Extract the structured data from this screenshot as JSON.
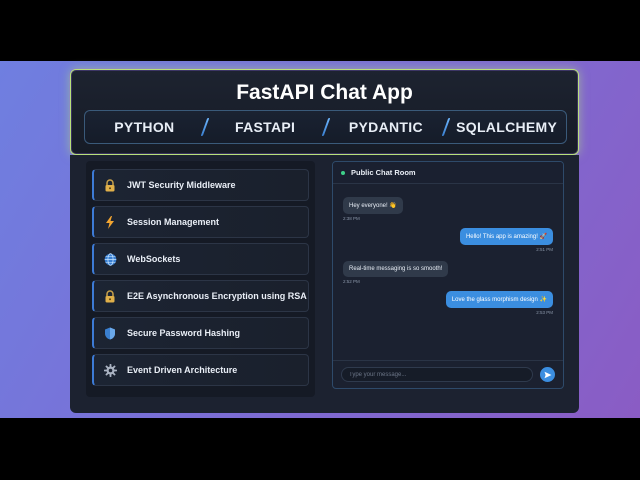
{
  "app": {
    "title": "FastAPI Chat App"
  },
  "tech_stack": [
    "PYTHON",
    "FASTAPI",
    "PYDANTIC",
    "SQLALCHEMY"
  ],
  "features": [
    {
      "label": "JWT Security Middleware",
      "icon": "lock-icon"
    },
    {
      "label": "Session Management",
      "icon": "lightning-icon"
    },
    {
      "label": "WebSockets",
      "icon": "globe-icon"
    },
    {
      "label": "E2E Asynchronous Encryption using RSA",
      "icon": "lock-icon"
    },
    {
      "label": "Secure Password Hashing",
      "icon": "shield-icon"
    },
    {
      "label": "Event Driven Architecture",
      "icon": "gear-icon"
    }
  ],
  "chat": {
    "room_title": "Public Chat Room",
    "messages": [
      {
        "text": "Hey everyone! 👋",
        "time": "2:38 PM",
        "direction": "in"
      },
      {
        "text": "Hello! This app is amazing! 🚀",
        "time": "2:51 PM",
        "direction": "out"
      },
      {
        "text": "Real-time messaging is so smooth!",
        "time": "2:52 PM",
        "direction": "in"
      },
      {
        "text": "Love the glass morphism design ✨",
        "time": "2:53 PM",
        "direction": "out"
      }
    ],
    "input_placeholder": "Type your message...",
    "send_icon": "send-icon"
  },
  "colors": {
    "accent_blue": "#3b8ee0",
    "header_glow": "#b8e07a",
    "online": "#3ed08a"
  }
}
